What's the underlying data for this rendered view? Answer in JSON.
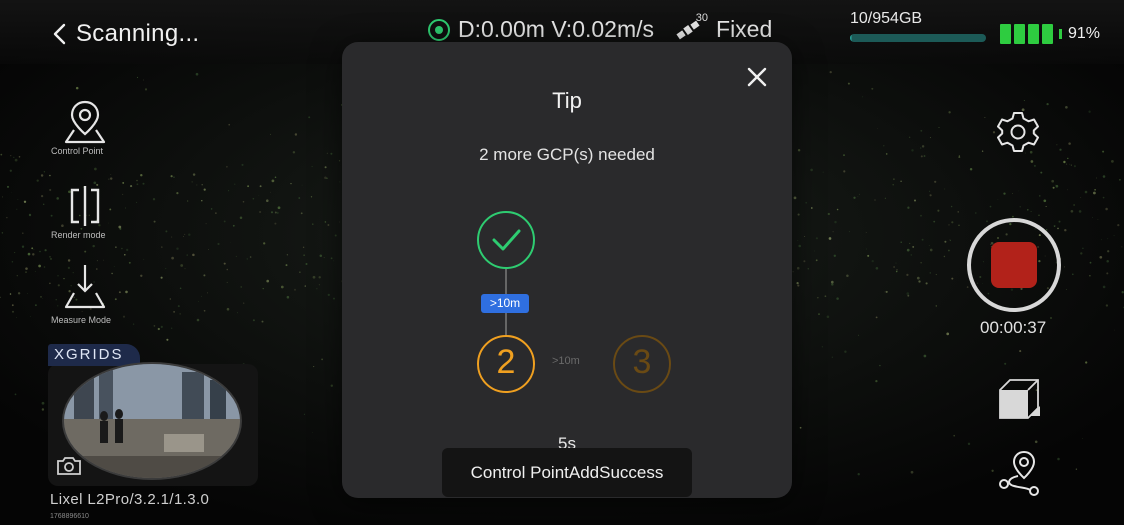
{
  "header": {
    "back_icon": "chevron-left-icon",
    "title": "Scanning...",
    "gps_status": "D:0.00m V:0.02m/s",
    "satellite_count": "30",
    "fix_status": "Fixed",
    "storage": "10/954GB",
    "battery_percent": "91%",
    "battery_level": 0.91,
    "storage_fraction": 0.01
  },
  "tools": {
    "control_point": "Control Point",
    "render_mode": "Render mode",
    "measure_mode": "Measure Mode"
  },
  "preview": {
    "brand": "XGRIDS",
    "device": "Lixel L2Pro/3.2.1/1.3.0",
    "serial": "1768896610",
    "camera_icon": "camera-icon"
  },
  "right": {
    "settings_icon": "gear-icon",
    "record_time": "00:00:37",
    "view_icon": "cube-icon",
    "route_icon": "route-pin-icon"
  },
  "modal": {
    "title": "Tip",
    "message": "2 more GCP(s) needed",
    "step1_distance": ">10m",
    "step2_label": "2",
    "step2_distance": ">10m",
    "step3_label": "3",
    "countdown": "5s"
  },
  "toast": {
    "message": "Control PointAddSuccess"
  },
  "colors": {
    "accent_green": "#2ecc71",
    "accent_orange": "#f0a020",
    "record_red": "#b2221a",
    "tag_blue": "#2f6fe0"
  }
}
